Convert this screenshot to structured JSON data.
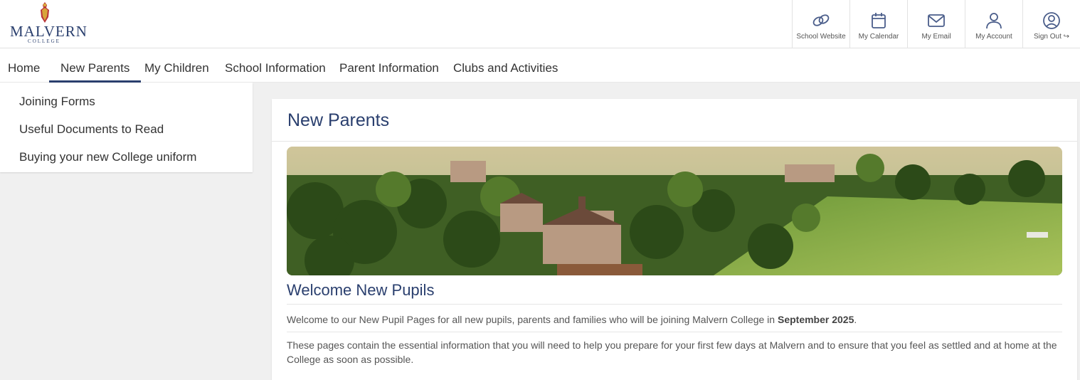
{
  "logo": {
    "name": "MALVERN",
    "sub": "COLLEGE"
  },
  "quick_links": [
    {
      "label": "School Website",
      "icon": "chain-link-icon"
    },
    {
      "label": "My Calendar",
      "icon": "calendar-icon"
    },
    {
      "label": "My Email",
      "icon": "envelope-icon"
    },
    {
      "label": "My Account",
      "icon": "person-icon"
    },
    {
      "label": "Sign Out",
      "icon": "sign-out-icon"
    }
  ],
  "nav": [
    {
      "label": "Home"
    },
    {
      "label": "New Parents",
      "active": true
    },
    {
      "label": "My Children"
    },
    {
      "label": "School Information"
    },
    {
      "label": "Parent Information"
    },
    {
      "label": "Clubs and Activities"
    }
  ],
  "sidebar": [
    {
      "label": "Joining Forms"
    },
    {
      "label": "Useful Documents to Read"
    },
    {
      "label": "Buying your new College uniform"
    }
  ],
  "main": {
    "title": "New Parents",
    "heading": "Welcome New Pupils",
    "intro": "Welcome to our New Pupil Pages for all new pupils, parents and families who will be joining Malvern College in",
    "intro_date": "September 2025",
    "intro_end": ".",
    "body": "These pages contain the essential information that you will need to help you prepare for your first few days at Malvern and to ensure that you feel as settled and at home at the College as soon as possible."
  },
  "colors": {
    "brand": "#2a3f6e",
    "accent_icon": "#4a5d8a"
  }
}
